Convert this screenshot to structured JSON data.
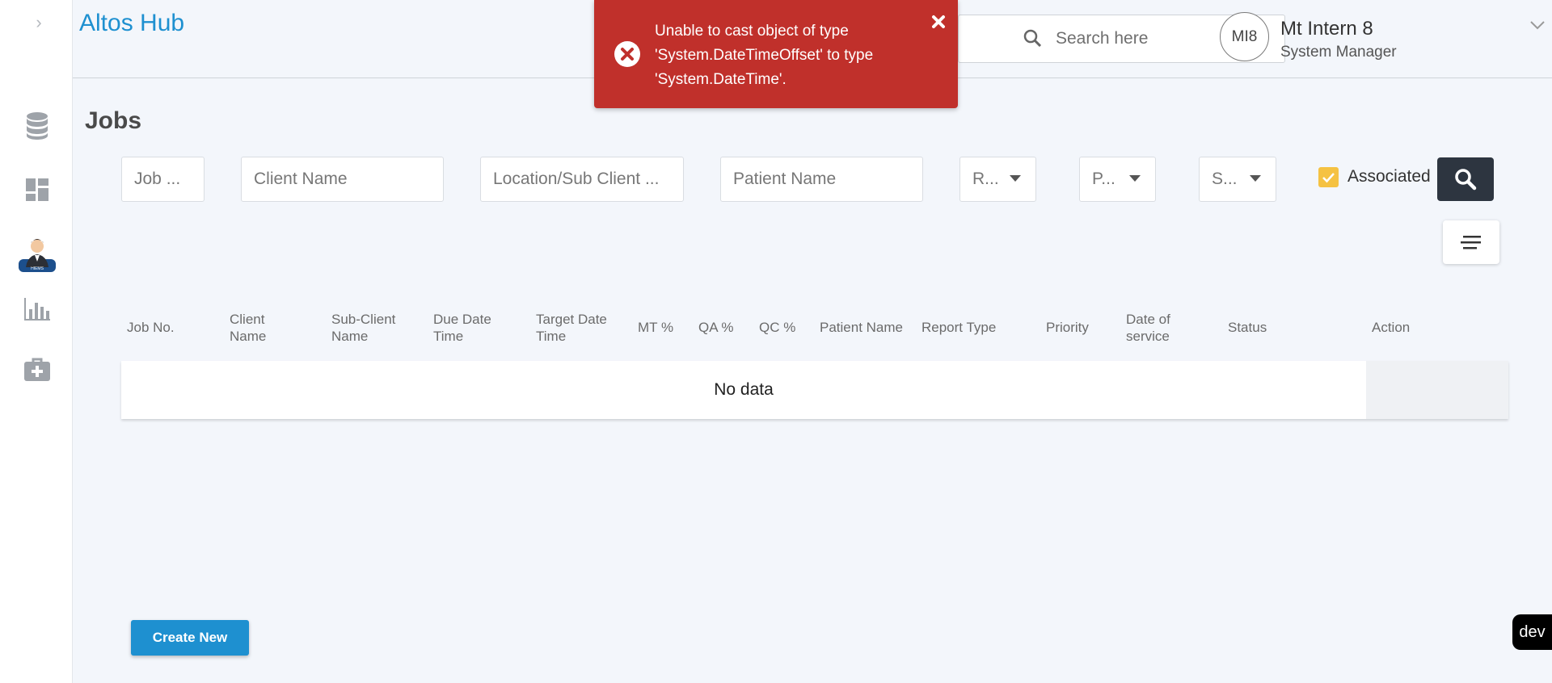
{
  "app": {
    "brand": "Altos Hub"
  },
  "header": {
    "search_placeholder": "Search here",
    "user": {
      "initials": "MI8",
      "name": "Mt Intern 8",
      "role": "System Manager"
    }
  },
  "toast": {
    "message": "Unable to cast object of type 'System.DateTimeOffset' to type 'System.DateTime'.",
    "color": "#c0302b"
  },
  "sidebar": {
    "items": [
      {
        "icon": "database-icon"
      },
      {
        "icon": "dashboard-icon"
      },
      {
        "icon": "hiems-avatar-icon",
        "badge": "HIEMS"
      },
      {
        "icon": "bar-chart-icon"
      },
      {
        "icon": "medical-kit-icon"
      }
    ]
  },
  "page": {
    "title": "Jobs"
  },
  "filters": {
    "job_no": "Job ...",
    "client_name": "Client Name",
    "location": "Location/Sub Client ...",
    "patient_name": "Patient Name",
    "report_type": "R...",
    "priority": "P...",
    "status": "S...",
    "associated_label": "Associated",
    "associated_checked": true
  },
  "table": {
    "columns": [
      [
        "Job No."
      ],
      [
        "Client",
        "Name"
      ],
      [
        "Sub-Client",
        "Name"
      ],
      [
        "Due Date",
        "Time"
      ],
      [
        "Target Date",
        "Time"
      ],
      [
        "MT %"
      ],
      [
        "QA %"
      ],
      [
        "QC %"
      ],
      [
        "Patient Name"
      ],
      [
        "Report Type"
      ],
      [
        "Priority"
      ],
      [
        "Date of",
        "service"
      ],
      [
        "Status"
      ],
      [
        "Action"
      ]
    ],
    "empty_text": "No data"
  },
  "actions": {
    "create_new": "Create New"
  },
  "env_badge": "dev",
  "colors": {
    "brand": "#1e90d0",
    "checkbox": "#f5c242",
    "search_button": "#2d3540"
  }
}
